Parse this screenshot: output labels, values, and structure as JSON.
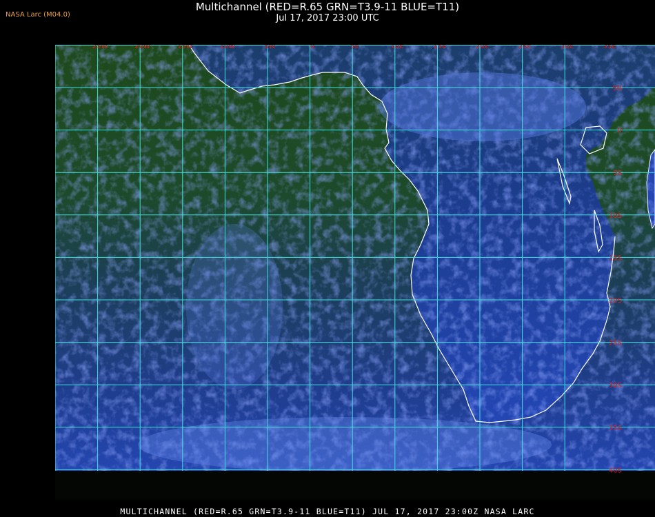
{
  "header": {
    "logo": "NASA Larc (M04.0)",
    "title": "Multichannel (RED=R.65 GRN=T3.9-11 BLUE=T11)",
    "subtitle": "Jul 17, 2017 23:00 UTC"
  },
  "footer": {
    "caption": "MULTICHANNEL (RED=R.65 GRN=T3.9-11 BLUE=T11) JUL 17, 2017 23:00Z  NASA LARC"
  },
  "map": {
    "longitude_labels": [
      "25W",
      "20W",
      "15W",
      "10W",
      "5W",
      "0",
      "5E",
      "10E",
      "15E",
      "20E",
      "25E",
      "30E",
      "35E"
    ],
    "latitude_labels": [
      "5N",
      "0",
      "5S",
      "10S",
      "15S",
      "20S",
      "25S",
      "30S",
      "35S",
      "40S"
    ],
    "colors": {
      "grid": "#40e0e0",
      "labels": "#d42020",
      "coastline": "#ffffff",
      "ocean_green": "#1f4a1c",
      "land_blue": "#1c3a8c",
      "cloud": "#6a8ef0"
    }
  }
}
